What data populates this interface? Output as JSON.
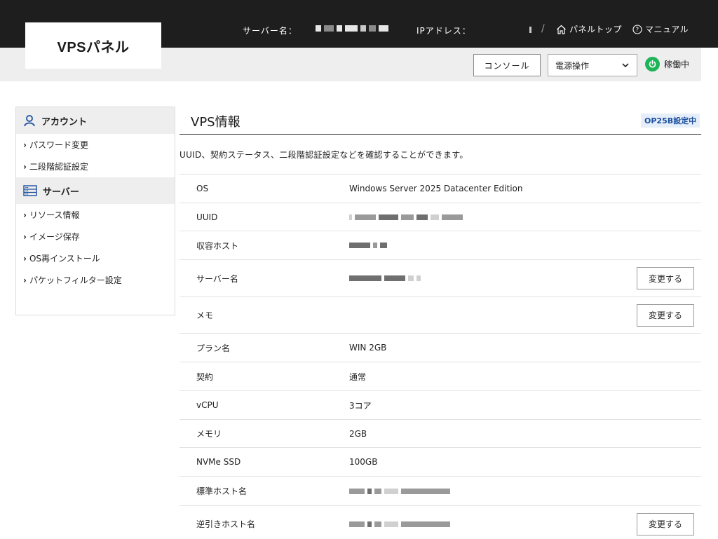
{
  "header": {
    "logo": "VPSパネル",
    "server_name_label": "サーバー名：",
    "ip_label": "IPアドレス：",
    "separator": "/",
    "panel_top": "パネルトップ",
    "manual": "マニュアル"
  },
  "toolbar": {
    "console_label": "コンソール",
    "power_select_value": "電源操作",
    "status_label": "稼働中",
    "status_color": "#20b45a"
  },
  "sidebar": {
    "sections": [
      {
        "title": "アカウント",
        "icon": "person-icon",
        "items": [
          "パスワード変更",
          "二段階認証設定"
        ]
      },
      {
        "title": "サーバー",
        "icon": "server-icon",
        "items": [
          "リソース情報",
          "イメージ保存",
          "OS再インストール",
          "パケットフィルター設定"
        ]
      }
    ]
  },
  "main": {
    "title": "VPS情報",
    "badge": "OP25B設定中",
    "description": "UUID、契約ステータス、二段階認証設定などを確認することができます。",
    "edit_label": "変更する",
    "rows": [
      {
        "label": "OS",
        "value": "Windows Server 2025 Datacenter Edition"
      },
      {
        "label": "UUID",
        "value": ""
      },
      {
        "label": "収容ホスト",
        "value": ""
      },
      {
        "label": "サーバー名",
        "value": ""
      },
      {
        "label": "メモ",
        "value": ""
      },
      {
        "label": "プラン名",
        "value": "WIN 2GB"
      },
      {
        "label": "契約",
        "value": "通常"
      },
      {
        "label": "vCPU",
        "value": "3コア"
      },
      {
        "label": "メモリ",
        "value": "2GB"
      },
      {
        "label": "NVMe SSD",
        "value": "100GB"
      },
      {
        "label": "標準ホスト名",
        "value": ""
      },
      {
        "label": "逆引きホスト名",
        "value": ""
      }
    ]
  }
}
